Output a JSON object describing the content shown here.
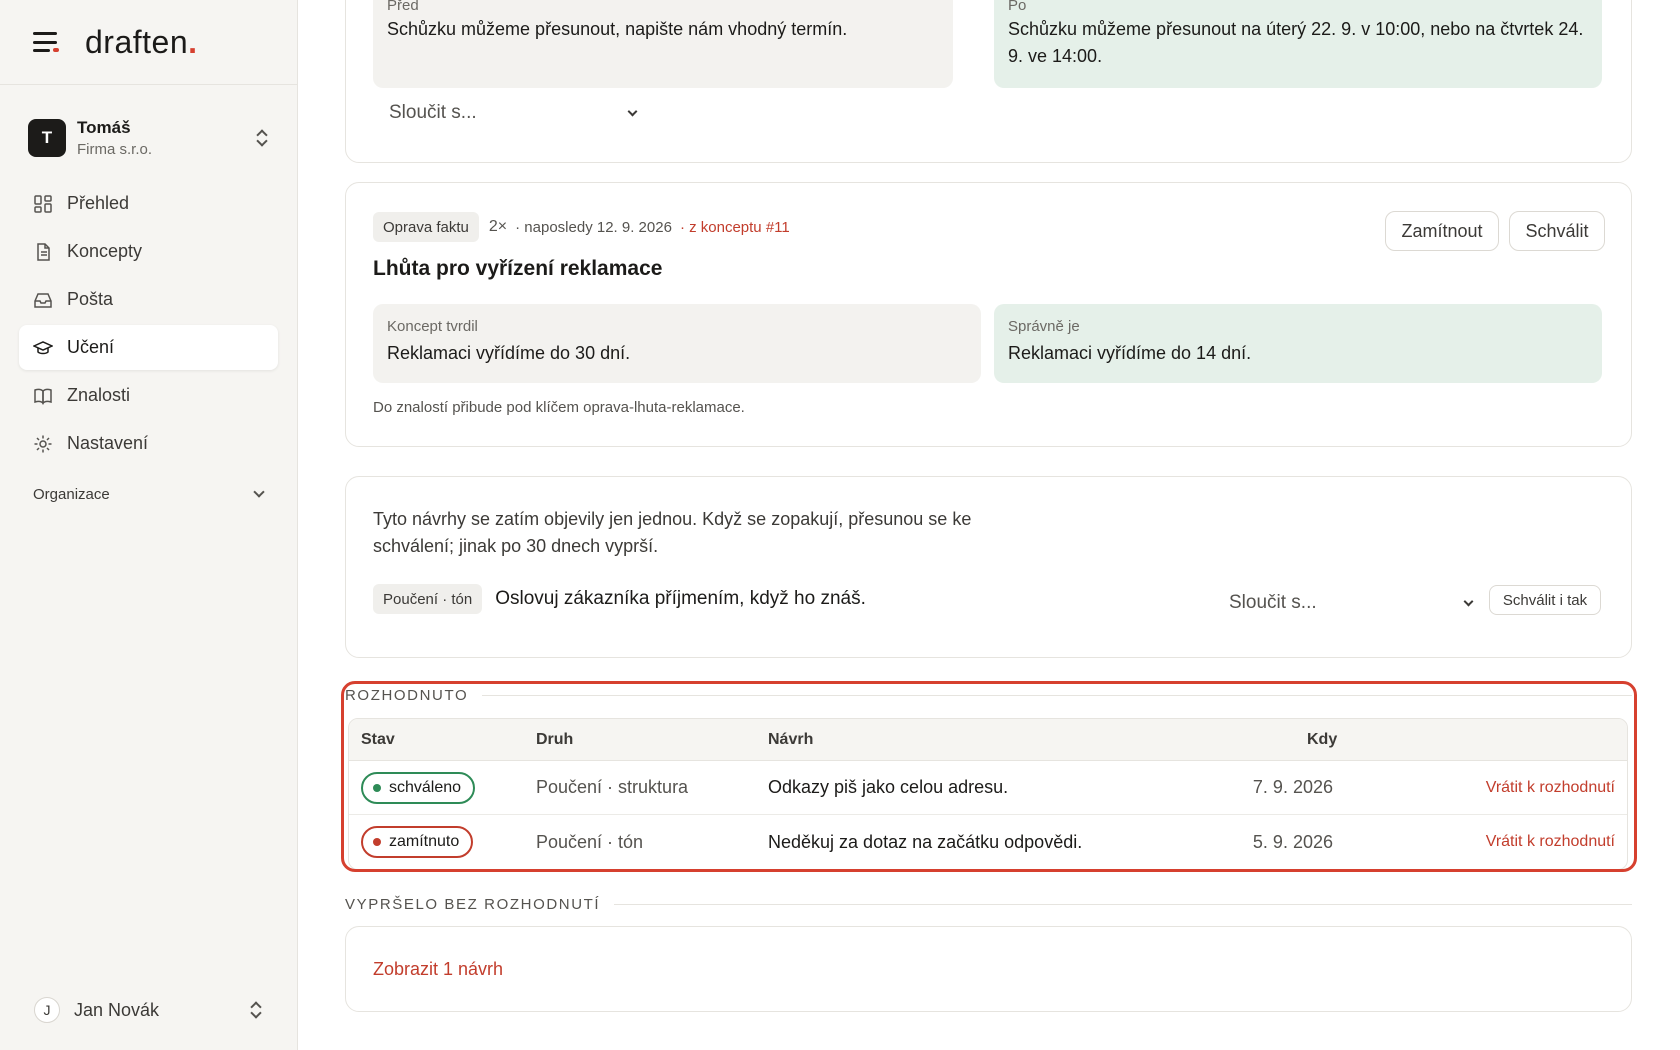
{
  "brand": {
    "name": "draften",
    "dot": "."
  },
  "workspace": {
    "initial": "T",
    "name": "Tomáš",
    "company": "Firma s.r.o."
  },
  "nav": {
    "items": [
      {
        "label": "Přehled",
        "icon": "grid-icon"
      },
      {
        "label": "Koncepty",
        "icon": "document-icon"
      },
      {
        "label": "Pošta",
        "icon": "inbox-icon"
      },
      {
        "label": "Učení",
        "icon": "graduation-cap-icon",
        "active": true
      },
      {
        "label": "Znalosti",
        "icon": "book-icon"
      },
      {
        "label": "Nastavení",
        "icon": "gear-icon"
      }
    ],
    "org_label": "Organizace"
  },
  "user": {
    "initial": "J",
    "name": "Jan Novák"
  },
  "card_top": {
    "before_label": "Před",
    "before_text": "Schůzku můžeme přesunout, napište nám vhodný termín.",
    "after_label": "Po",
    "after_text": "Schůzku můžeme přesunout na úterý 22. 9. v 10:00, nebo na čtvrtek 24. 9. ve 14:00.",
    "merge_placeholder": "Sloučit s..."
  },
  "card_fact": {
    "tag": "Oprava faktu",
    "count": "2×",
    "last": "· naposledy 12. 9. 2026",
    "source": "· z konceptu #11",
    "title": "Lhůta pro vyřízení reklamace",
    "reject_label": "Zamítnout",
    "approve_label": "Schválit",
    "claim_label": "Koncept tvrdil",
    "claim_text": "Reklamaci vyřídíme do 30 dní.",
    "correct_label": "Správně je",
    "correct_text": "Reklamaci vyřídíme do 14 dní.",
    "footnote": "Do znalostí přibude pod klíčem oprava-lhuta-reklamace."
  },
  "card_pending": {
    "info": "Tyto návrhy se zatím objevily jen jednou. Když se zopakují, přesunou se ke schválení; jinak po 30 dnech vyprší.",
    "tag": "Poučení · tón",
    "text": "Oslovuj zákazníka příjmením, když ho znáš.",
    "merge_placeholder": "Sloučit s...",
    "approve_anyway": "Schválit i tak"
  },
  "decided": {
    "heading": "ROZHODNUTO",
    "columns": {
      "status": "Stav",
      "kind": "Druh",
      "proposal": "Návrh",
      "when": "Kdy"
    },
    "rows": [
      {
        "status": "schváleno",
        "status_color": "#2e8b57",
        "kind": "Poučení · struktura",
        "proposal": "Odkazy piš jako celou adresu.",
        "when": "7. 9. 2026",
        "action": "Vrátit k rozhodnutí"
      },
      {
        "status": "zamítnuto",
        "status_color": "#c23d2c",
        "kind": "Poučení · tón",
        "proposal": "Neděkuj za dotaz na začátku odpovědi.",
        "when": "5. 9. 2026",
        "action": "Vrátit k rozhodnutí"
      }
    ]
  },
  "expired": {
    "heading": "VYPRŠELO BEZ ROZHODNUTÍ",
    "show_link": "Zobrazit 1 návrh"
  },
  "colors": {
    "accent": "#d6402f",
    "approved": "#2e8b57",
    "rejected": "#c23d2c",
    "green_box": "#e5f0e9",
    "grey_box": "#f3f2ef"
  }
}
